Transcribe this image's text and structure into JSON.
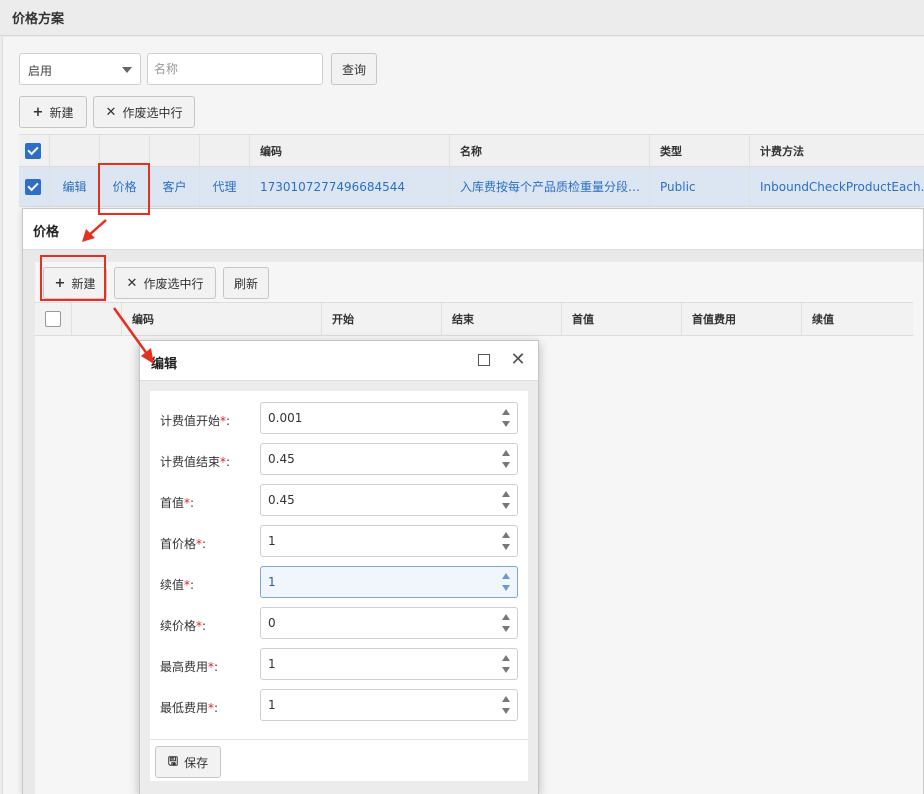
{
  "page": {
    "title": "价格方案"
  },
  "filters": {
    "status_value": "启用",
    "name_placeholder": "名称",
    "query_label": "查询"
  },
  "toolbar": {
    "new_label": "新建",
    "void_label": "作废选中行"
  },
  "grid": {
    "headers": [
      "编码",
      "名称",
      "类型",
      "计费方法"
    ],
    "row": {
      "actions": [
        "编辑",
        "价格",
        "客户",
        "代理"
      ],
      "code": "1730107277496684544",
      "name": "入库费按每个产品质检重量分段…",
      "type": "Public",
      "method": "InboundCheckProductEach…"
    }
  },
  "price_window": {
    "title": "价格",
    "toolbar": {
      "new_label": "新建",
      "void_label": "作废选中行",
      "refresh_label": "刷新"
    },
    "headers": [
      "编码",
      "开始",
      "结束",
      "首值",
      "首值费用",
      "续值"
    ]
  },
  "edit_dialog": {
    "title": "编辑",
    "fields": [
      {
        "label": "计费值开始",
        "value": "0.001"
      },
      {
        "label": "计费值结束",
        "value": "0.45"
      },
      {
        "label": "首值",
        "value": "0.45"
      },
      {
        "label": "首价格",
        "value": "1"
      },
      {
        "label": "续值",
        "value": "1"
      },
      {
        "label": "续价格",
        "value": "0"
      },
      {
        "label": "最高费用",
        "value": "1"
      },
      {
        "label": "最低费用",
        "value": "1"
      }
    ],
    "required_mark": "*",
    "colon": ":",
    "save_label": "保存"
  },
  "colors": {
    "accent": "#2d6ec9",
    "annotation": "#e53020",
    "required": "#e02020"
  }
}
